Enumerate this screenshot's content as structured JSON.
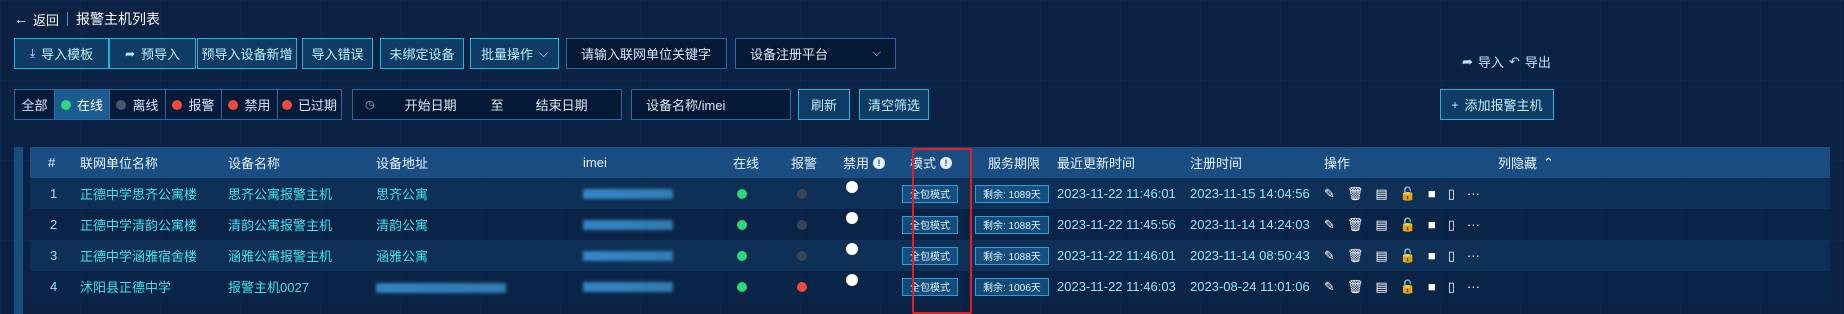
{
  "header": {
    "back_label": "返回",
    "title": "报警主机列表"
  },
  "toolbar": {
    "import_template": "导入模板",
    "pre_import": "预导入",
    "pre_import_new": "预导入设备新增",
    "import_error": "导入错误",
    "unbound_device": "未绑定设备",
    "batch_ops": "批量操作",
    "keyword_placeholder": "请输入联网单位关键字",
    "platform_label": "设备注册平台",
    "import": "导入",
    "export": "导出"
  },
  "filters": {
    "all": "全部",
    "statuses": [
      {
        "label": "在线",
        "color": "#2fd67a"
      },
      {
        "label": "离线",
        "color": "#4a5566"
      },
      {
        "label": "报警",
        "color": "#f04a3c"
      },
      {
        "label": "禁用",
        "color": "#f04a3c"
      },
      {
        "label": "已过期",
        "color": "#f04a3c"
      }
    ],
    "start_date": "开始日期",
    "to": "至",
    "end_date": "结束日期",
    "device_search_placeholder": "设备名称/imei",
    "refresh": "刷新",
    "clear": "清空筛选",
    "add_host": "添加报警主机"
  },
  "table": {
    "columns": [
      "#",
      "联网单位名称",
      "设备名称",
      "设备地址",
      "imei",
      "在线",
      "报警",
      "禁用",
      "模式",
      "服务期限",
      "最近更新时间",
      "注册时间",
      "操作",
      "列隐藏"
    ],
    "rows": [
      {
        "idx": "1",
        "unit": "正德中学思齐公寓楼",
        "device": "思齐公寓报警主机",
        "address": "思齐公寓",
        "online": true,
        "alarm": false,
        "mode": "全包模式",
        "service": "剩余: 1089天",
        "updated": "2023-11-22 11:46:01",
        "registered": "2023-11-15 14:04:56"
      },
      {
        "idx": "2",
        "unit": "正德中学清韵公寓楼",
        "device": "清韵公寓报警主机",
        "address": "清韵公寓",
        "online": true,
        "alarm": false,
        "mode": "全包模式",
        "service": "剩余: 1088天",
        "updated": "2023-11-22 11:45:56",
        "registered": "2023-11-14 14:24:03"
      },
      {
        "idx": "3",
        "unit": "正德中学涵雅宿舍楼",
        "device": "涵雅公寓报警主机",
        "address": "涵雅公寓",
        "online": true,
        "alarm": false,
        "mode": "全包模式",
        "service": "剩余: 1088天",
        "updated": "2023-11-22 11:46:01",
        "registered": "2023-11-14 08:50:43"
      },
      {
        "idx": "4",
        "unit": "沭阳县正德中学",
        "device": "报警主机0027",
        "address": "",
        "online": true,
        "alarm": true,
        "mode": "全包模式",
        "service": "剩余: 1006天",
        "updated": "2023-11-22 11:46:03",
        "registered": "2023-08-24 11:01:06"
      }
    ],
    "colors": {
      "online": "#2fd67a",
      "alarm_on": "#f04a3c",
      "alarm_off": "#3a4658",
      "disabled_off": "#ffffff"
    }
  }
}
